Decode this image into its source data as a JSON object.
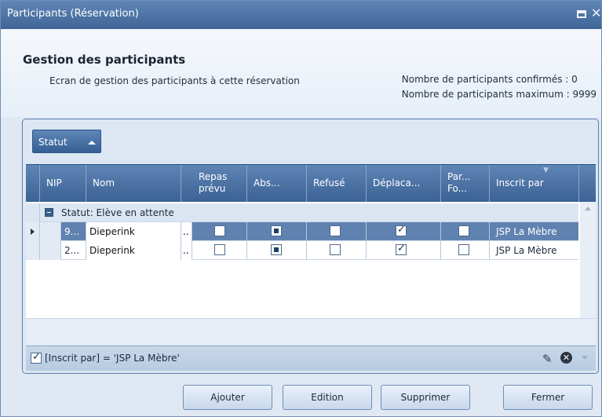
{
  "window": {
    "title": "Participants (Réservation)"
  },
  "header": {
    "title": "Gestion des participants",
    "subtitle": "Ecran de gestion des participants à cette réservation",
    "confirmed": "Nombre de participants confirmés : 0",
    "maximum": "Nombre de participants maximum : 9999"
  },
  "grid": {
    "group_button": "Statut",
    "columns": [
      "NIP",
      "Nom",
      "Repas prévu",
      "Abs...",
      "Refusé",
      "Déplaca...",
      "Par... Fo...",
      "Inscrit par"
    ],
    "group_row": "Statut: Elève en attente",
    "rows": [
      {
        "nip": "9...",
        "nom": "Dieperink",
        "extra": "..",
        "repas": false,
        "abs": "indeterminate",
        "refuse": false,
        "deplacement": true,
        "par_fo": false,
        "inscrit_par": "JSP La Mèbre"
      },
      {
        "nip": "2...",
        "nom": "Dieperink",
        "extra": "..",
        "repas": false,
        "abs": "indeterminate",
        "refuse": false,
        "deplacement": true,
        "par_fo": false,
        "inscrit_par": "JSP La Mèbre"
      }
    ],
    "filter": "[Inscrit par] = 'JSP La Mèbre'"
  },
  "buttons": {
    "add": "Ajouter",
    "edit": "Edition",
    "delete": "Supprimer",
    "close": "Fermer"
  },
  "colors": {
    "titlebar": "#4a72a4",
    "selected_row": "#5f82b0",
    "column_header": "#4c73a5"
  }
}
